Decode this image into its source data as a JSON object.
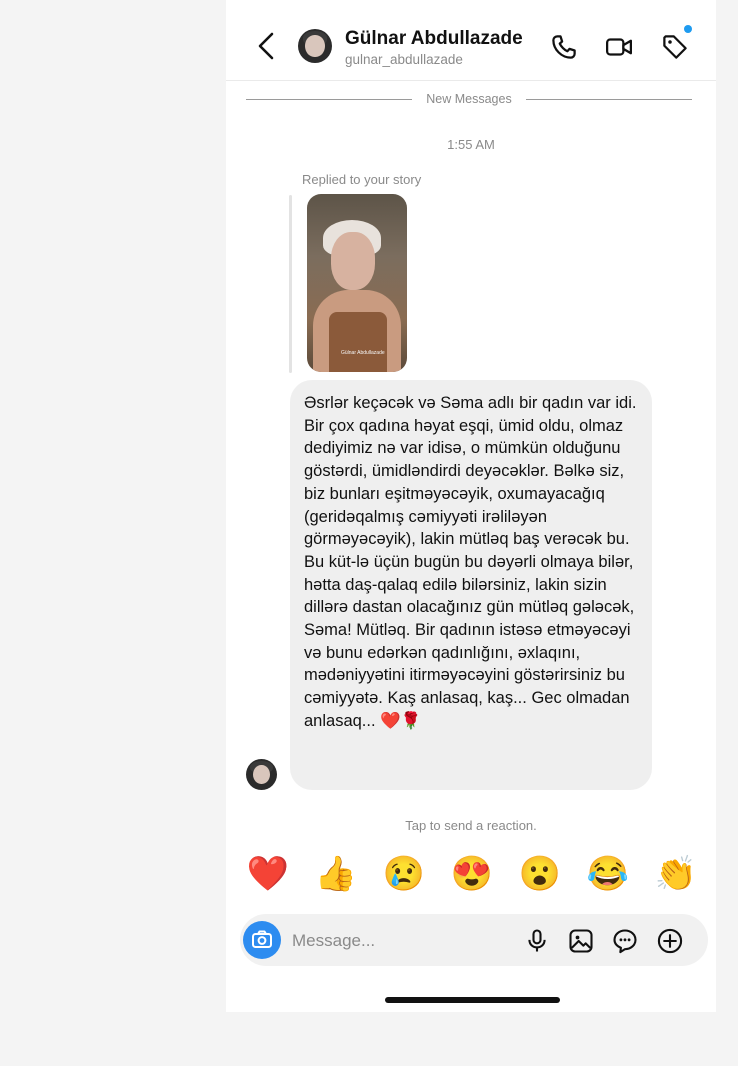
{
  "header": {
    "name": "Gülnar Abdullazade",
    "username": "gulnar_abdullazade",
    "icons": [
      "back-chevron-icon",
      "phone-icon",
      "video-icon",
      "tag-icon"
    ],
    "notification_dot_color": "#1e9bf0"
  },
  "thread": {
    "divider_label": "New Messages",
    "timestamp": "1:55 AM",
    "story_reply_label": "Replied to your story",
    "story_caption": "Gülnar Abdullazade",
    "message": "Əsrlər keçəcək və Səma adlı bir qadın var idi. Bir çox qadına həyat eşqi, ümid oldu, olmaz dediyimiz nə var idisə, o mümkün olduğunu göstərdi, ümidləndirdi deyəcəklər. Bəlkə siz, biz bunları eşitməyəcəyik, oxumayacağıq (geridəqalmış cəmiyyəti irəliləyən görməyəcəyik), lakin mütləq baş verəcək bu. Bu küt-lə üçün bugün bu dəyərli olmaya bilər, hətta daş-qalaq edilə bilərsiniz, lakin sizin dillərə dastan olacağınız gün mütləq gələcək, Səma! Mütləq. Bir qadının istəsə etməyəcəyi və bunu edərkən qadınlığını, əxlaqını, mədəniyyətini itirməyəcəyini göstərirsiniz bu cəmiyyətə. Kaş anlasaq, kaş... Gec olmadan anlasaq... ❤️🌹"
  },
  "reactions": {
    "hint": "Tap to send a reaction.",
    "emojis": [
      "❤️",
      "👍",
      "😢",
      "😍",
      "😮",
      "😂",
      "👏"
    ]
  },
  "composer": {
    "placeholder": "Message...",
    "value": "",
    "icons": [
      "camera-icon",
      "microphone-icon",
      "gallery-icon",
      "sticker-icon",
      "plus-icon"
    ],
    "camera_color": "#2d8cf0"
  }
}
